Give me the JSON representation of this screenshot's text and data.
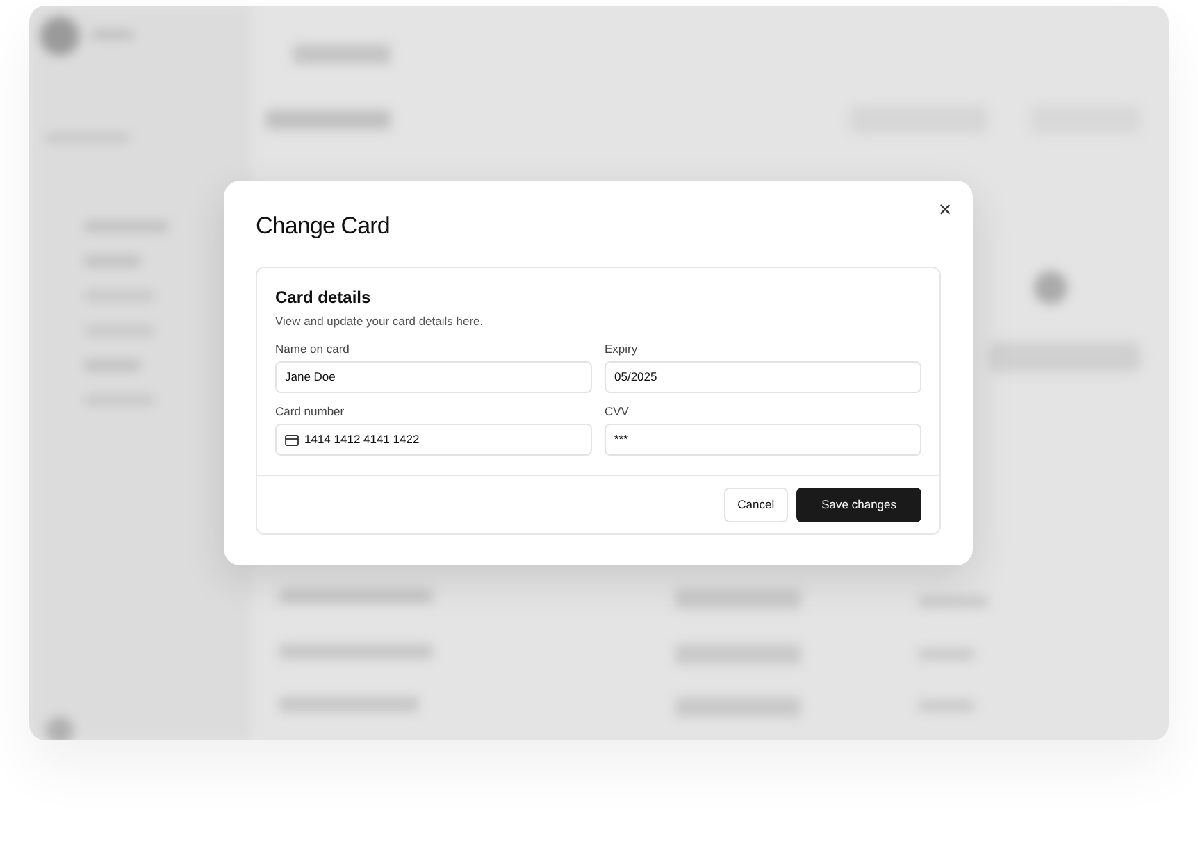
{
  "dialog": {
    "title": "Change Card",
    "close": "×",
    "card": {
      "title": "Card details",
      "description": "View and update your card details here.",
      "fields": [
        {
          "label": "Name on card",
          "value": "Jane Doe",
          "kind": "text"
        },
        {
          "label": "Expiry",
          "value": "05/2025",
          "kind": "text"
        },
        {
          "label": "Card number",
          "value": "1414 1412 4141 1422",
          "kind": "card"
        },
        {
          "label": "CVV",
          "value": "***",
          "kind": "text"
        }
      ],
      "buttons": [
        {
          "label": "Cancel",
          "kind": "secondary"
        },
        {
          "label": "Save changes",
          "kind": "primary"
        }
      ]
    }
  }
}
